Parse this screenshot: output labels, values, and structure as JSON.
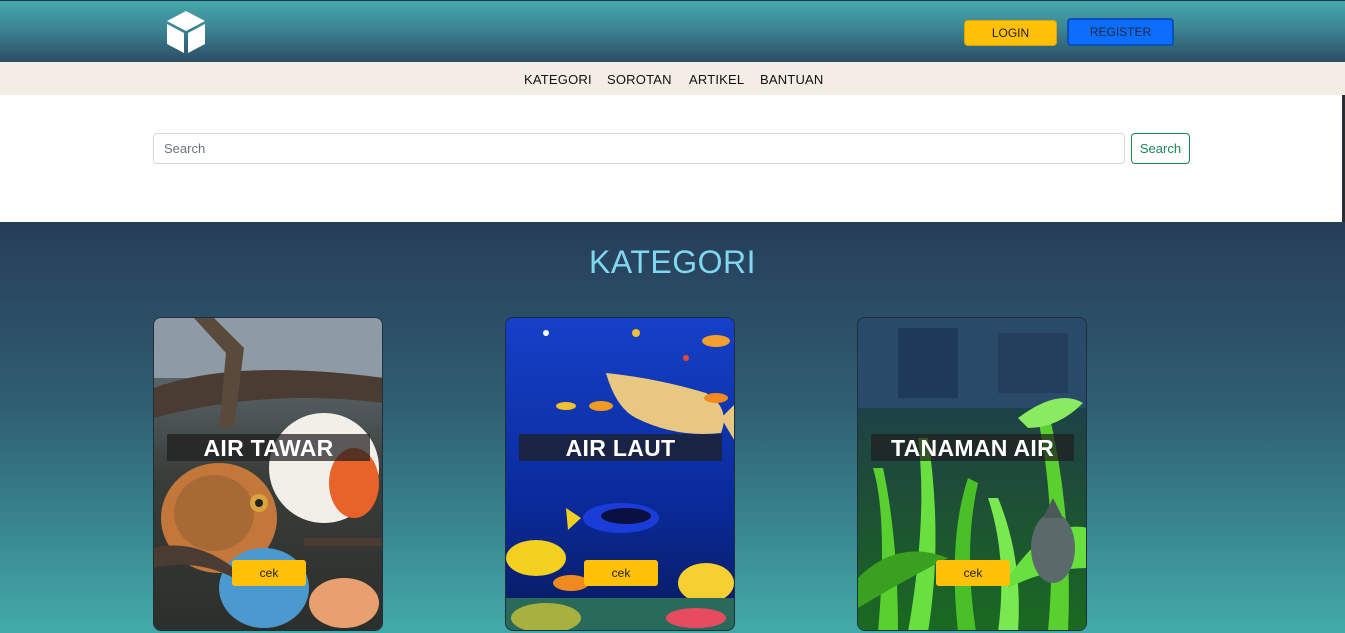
{
  "header": {
    "login_label": "LOGIN",
    "register_label": "REGISTER",
    "logo_icon": "cube-icon"
  },
  "nav": {
    "items": [
      "KATEGORI",
      "SOROTAN",
      "ARTIKEL",
      "BANTUAN"
    ]
  },
  "search": {
    "placeholder": "Search",
    "button_label": "Search"
  },
  "kategori": {
    "title": "KATEGORI",
    "cards": [
      {
        "label": "AIR TAWAR",
        "button": "cek"
      },
      {
        "label": "AIR LAUT",
        "button": "cek"
      },
      {
        "label": "TANAMAN AIR",
        "button": "cek"
      }
    ]
  },
  "colors": {
    "accent_yellow": "#ffc107",
    "accent_blue": "#0d6efd",
    "search_green": "#198754",
    "kategori_title": "#7fd8f0"
  }
}
